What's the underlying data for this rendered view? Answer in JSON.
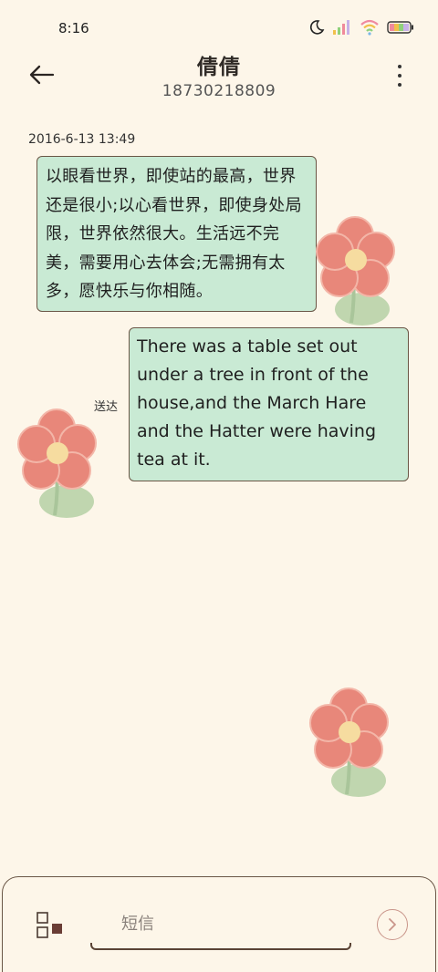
{
  "status_bar": {
    "time": "8:16",
    "icons": [
      "moon-icon",
      "signal-icon",
      "wifi-icon",
      "battery-icon"
    ]
  },
  "header": {
    "contact_name": "倩倩",
    "contact_number": "18730218809",
    "back_icon": "arrow-left-icon",
    "menu_icon": "more-vertical-icon"
  },
  "conversation": {
    "timestamp": "2016-6-13 13:49",
    "messages": [
      {
        "direction": "incoming",
        "text": "以眼看世界，即使站的最高，世界还是很小;以心看世界，即使身处局限，世界依然很大。生活远不完美，需要用心去体会;无需拥有太多，愿快乐与你相随。"
      },
      {
        "direction": "outgoing",
        "text": "There was a table set out under a tree in front of the house,and the March Hare and the Hatter were having tea at it.",
        "status": "送达"
      }
    ]
  },
  "composer": {
    "placeholder": "短信",
    "attach_icon": "attachment-icon",
    "send_icon": "send-arrow-icon"
  },
  "colors": {
    "background": "#fdf6e9",
    "bubble": "#c9ead4",
    "bubble_border": "#6a5646",
    "flower_petal": "#e8877a",
    "flower_center": "#f6dca0",
    "flower_leaf": "#b9d3a8"
  }
}
